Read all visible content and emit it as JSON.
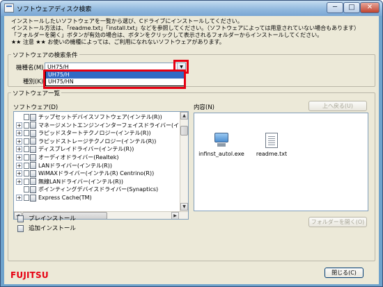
{
  "window": {
    "title": "ソフトウェアディスク検索",
    "min_label": "─",
    "max_label": "□",
    "close_label": "✕"
  },
  "intro": {
    "line1": "インストールしたいソフトウェアを一覧から選び、Cドライブにインストールしてください。",
    "line2": "インストール方法は、「readme.txt」「install.txt」などを参照してください。（ソフトウェアによっては用意されていない場合もあります）",
    "line3": "「フォルダーを開く」ボタンが有効の場合は、ボタンをクリックして表示されるフォルダーからインストールしてください。",
    "line4": "★★ 注意 ★★ お使いの機種によっては、ご利用になれないソフトウェアがあります。"
  },
  "search": {
    "group_label": "ソフトウェアの検索条件",
    "model_label": "機種名(M)",
    "model_value": "UH75/H",
    "type_label": "種別(K)",
    "dropdown_options": [
      "UH75/H",
      "UH75/HN"
    ],
    "dropdown_selected": "UH75/H"
  },
  "list": {
    "group_label": "ソフトウェア一覧",
    "software_label": "ソフトウェア(D)",
    "content_label": "内容(N)",
    "back_button": "上へ戻る(U)",
    "open_folder_button": "フォルダーを開く(O)",
    "items": [
      {
        "label": "チップセットデバイスソフトウェア(インテル(R))",
        "expand": "blank"
      },
      {
        "label": "マネージメントエンジンインターフェイスドライバー(インテル",
        "expand": "+"
      },
      {
        "label": "ラピッドスタートテクノロジー(インテル(R))",
        "expand": "+"
      },
      {
        "label": "ラピッドストレージテクノロジー(インテル(R))",
        "expand": "+"
      },
      {
        "label": "ディスプレイドライバー(インテル(R))",
        "expand": "+"
      },
      {
        "label": "オーディオドライバー(Realtek)",
        "expand": "+"
      },
      {
        "label": "LANドライバー(インテル(R))",
        "expand": "+"
      },
      {
        "label": "WiMAXドライバー(インテル(R) Centrino(R))",
        "expand": "+"
      },
      {
        "label": "無線LANドライバー(インテル(R))",
        "expand": "+"
      },
      {
        "label": "ポインティングデバイスドライバー(Synaptics)",
        "expand": "blank"
      },
      {
        "label": "Express Cache(TM)",
        "expand": "+"
      }
    ],
    "files": [
      {
        "name": "infinst_autol.exe",
        "icon": "exe-icon"
      },
      {
        "name": "readme.txt",
        "icon": "text-file-icon"
      }
    ]
  },
  "legend": {
    "preinstall": "プレインストール",
    "additional": "追加インストール"
  },
  "footer": {
    "logo": "FUJITSU",
    "close_button": "閉じる(C)"
  }
}
